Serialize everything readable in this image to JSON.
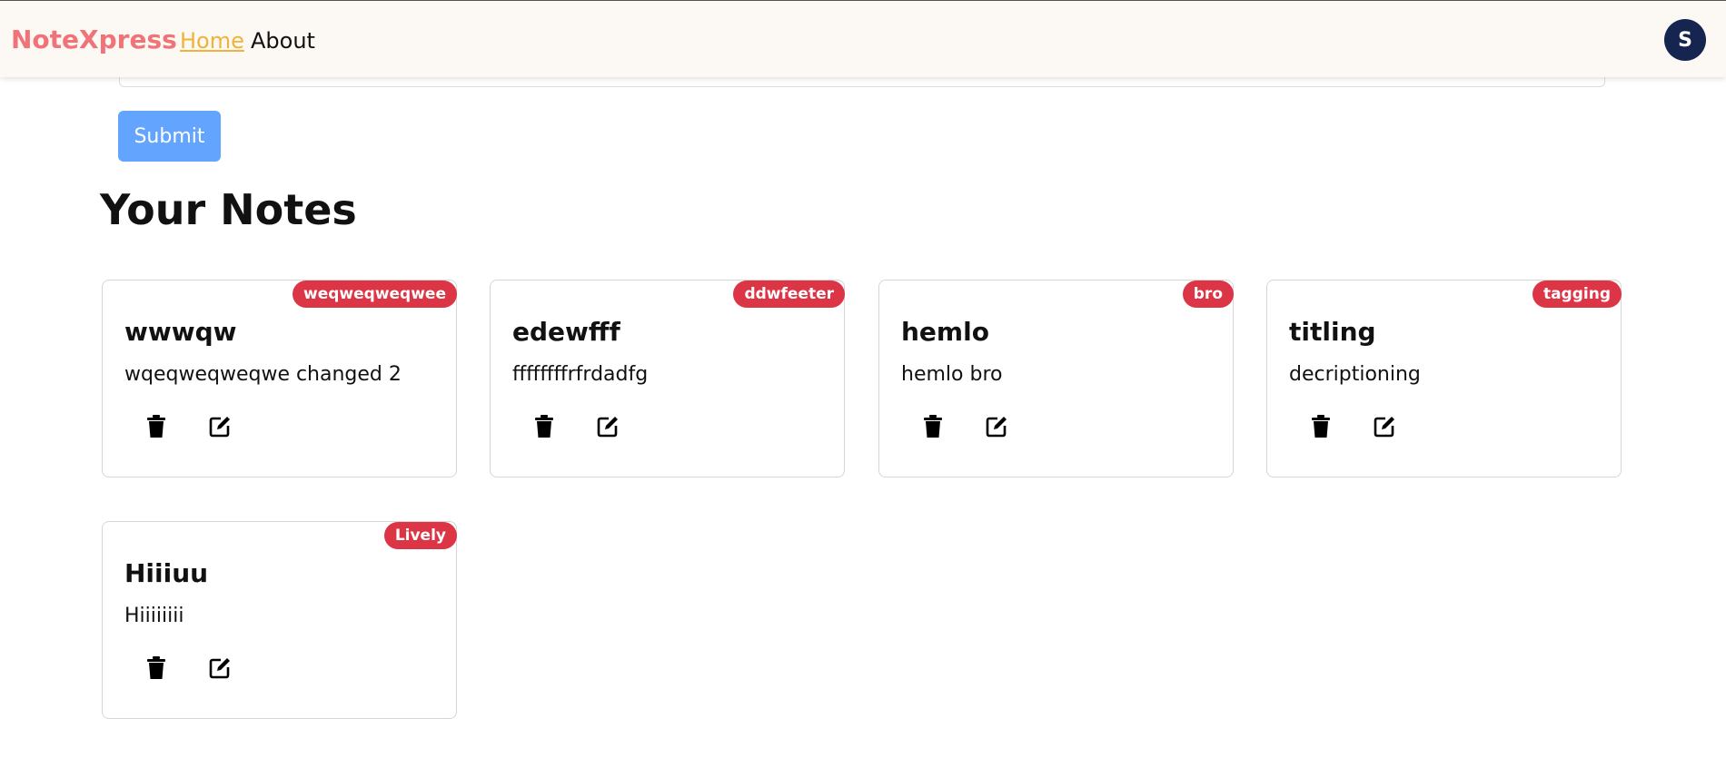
{
  "navbar": {
    "brand": "NoteXpress",
    "links": [
      {
        "label": "Home"
      },
      {
        "label": "About"
      }
    ],
    "avatar_initial": "S"
  },
  "form": {
    "submit_label": "Submit"
  },
  "notes_section": {
    "title": "Your Notes",
    "notes": [
      {
        "tag": "weqweqweqwee",
        "title": "wwwqw",
        "description": "wqeqweqweqwe changed 2"
      },
      {
        "tag": "ddwfeeter",
        "title": "edewfff",
        "description": "ffffffffrfrdadfg"
      },
      {
        "tag": "bro",
        "title": "hemlo",
        "description": "hemlo bro"
      },
      {
        "tag": "tagging",
        "title": "titling",
        "description": "decriptioning"
      },
      {
        "tag": "Lively",
        "title": "Hiiiuu",
        "description": "Hiiiiiiii"
      }
    ]
  },
  "icons": {
    "delete": "trash-icon",
    "edit": "edit-icon"
  },
  "colors": {
    "brand": "#f07378",
    "active_link": "#f0b23a",
    "tag": "#dc3545",
    "submit": "#63a4ff",
    "avatar": "#16254f"
  }
}
